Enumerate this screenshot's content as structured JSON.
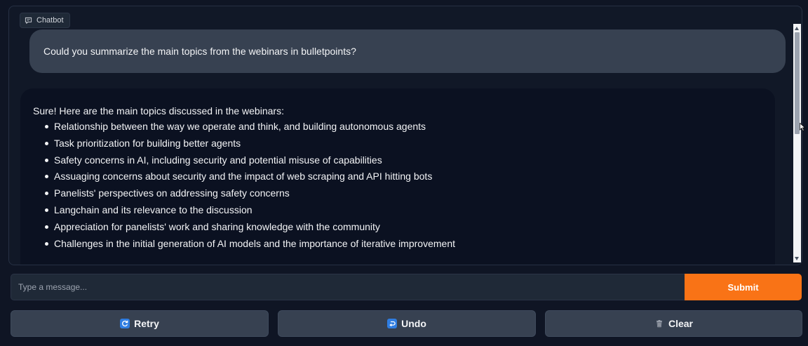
{
  "chatbot": {
    "label": "Chatbot",
    "label_icon": "chat-bubble-icon"
  },
  "messages": {
    "user": "Could you summarize the main topics from the webinars in bulletpoints?",
    "bot_intro": "Sure! Here are the main topics discussed in the webinars:",
    "bot_bullets": [
      "Relationship between the way we operate and think, and building autonomous agents",
      "Task prioritization for building better agents",
      "Safety concerns in AI, including security and potential misuse of capabilities",
      "Assuaging concerns about security and the impact of web scraping and API hitting bots",
      "Panelists' perspectives on addressing safety concerns",
      "Langchain and its relevance to the discussion",
      "Appreciation for panelists' work and sharing knowledge with the community",
      "Challenges in the initial generation of AI models and the importance of iterative improvement"
    ]
  },
  "input": {
    "placeholder": "Type a message...",
    "value": "",
    "submit_label": "Submit"
  },
  "buttons": {
    "retry_label": "Retry",
    "retry_icon": "refresh-icon",
    "undo_label": "Undo",
    "undo_icon": "undo-arrow-icon",
    "clear_label": "Clear",
    "clear_icon": "trash-icon"
  },
  "colors": {
    "accent": "#f97316",
    "background": "#0b0f19",
    "user_bubble": "#374151",
    "bot_bubble": "#0b1121"
  }
}
